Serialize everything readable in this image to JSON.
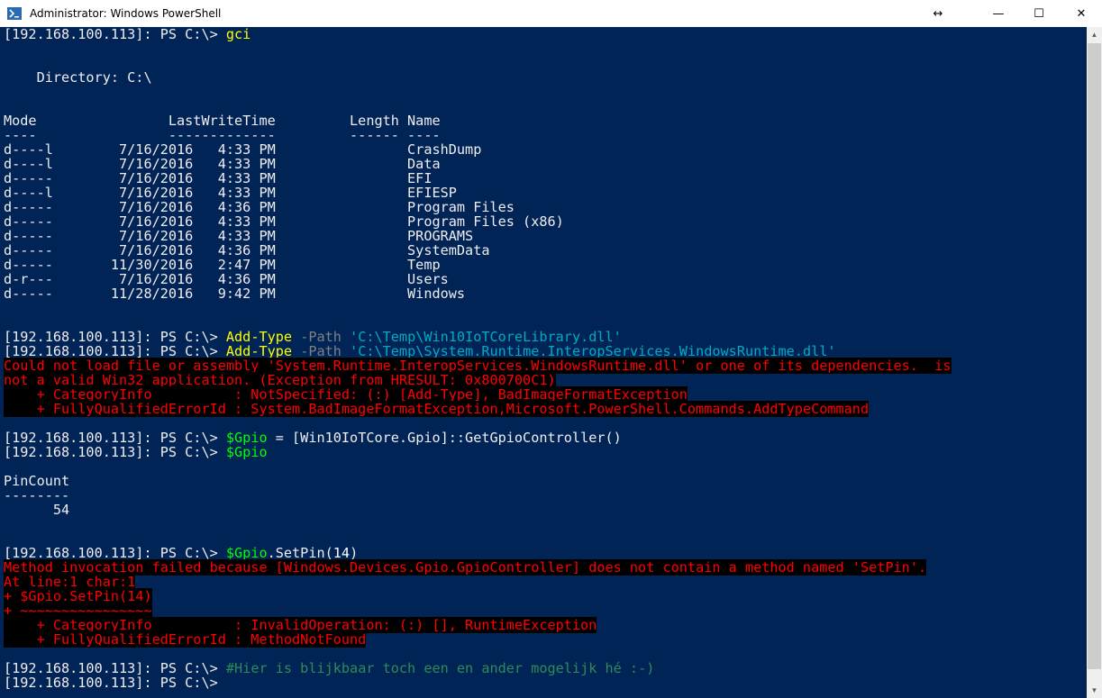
{
  "window": {
    "title": "Administrator: Windows PowerShell",
    "buttons": {
      "resize": "↔",
      "minimize": "—",
      "maximize": "☐",
      "close": "✕"
    }
  },
  "console": {
    "lines": [
      [
        {
          "t": "[192.168.100.113]: PS C:\\> ",
          "c": ""
        },
        {
          "t": "gci",
          "c": "cmd"
        }
      ],
      [],
      [],
      [
        {
          "t": "    Directory: C:\\",
          "c": ""
        }
      ],
      [],
      [],
      [
        {
          "t": "Mode                LastWriteTime         Length Name",
          "c": ""
        }
      ],
      [
        {
          "t": "----                -------------         ------ ----",
          "c": ""
        }
      ],
      [
        {
          "t": "d----l        7/16/2016   4:33 PM                CrashDump",
          "c": ""
        }
      ],
      [
        {
          "t": "d----l        7/16/2016   4:33 PM                Data",
          "c": ""
        }
      ],
      [
        {
          "t": "d-----        7/16/2016   4:33 PM                EFI",
          "c": ""
        }
      ],
      [
        {
          "t": "d----l        7/16/2016   4:33 PM                EFIESP",
          "c": ""
        }
      ],
      [
        {
          "t": "d-----        7/16/2016   4:36 PM                Program Files",
          "c": ""
        }
      ],
      [
        {
          "t": "d-----        7/16/2016   4:33 PM                Program Files (x86)",
          "c": ""
        }
      ],
      [
        {
          "t": "d-----        7/16/2016   4:33 PM                PROGRAMS",
          "c": ""
        }
      ],
      [
        {
          "t": "d-----        7/16/2016   4:36 PM                SystemData",
          "c": ""
        }
      ],
      [
        {
          "t": "d-----       11/30/2016   2:47 PM                Temp",
          "c": ""
        }
      ],
      [
        {
          "t": "d-r---        7/16/2016   4:36 PM                Users",
          "c": ""
        }
      ],
      [
        {
          "t": "d-----       11/28/2016   9:42 PM                Windows",
          "c": ""
        }
      ],
      [],
      [],
      [
        {
          "t": "[192.168.100.113]: PS C:\\> ",
          "c": ""
        },
        {
          "t": "Add-Type",
          "c": "cmd"
        },
        {
          "t": " -Path ",
          "c": "param"
        },
        {
          "t": "'C:\\Temp\\Win10IoTCoreLibrary.dll'",
          "c": "str"
        }
      ],
      [
        {
          "t": "[192.168.100.113]: PS C:\\> ",
          "c": ""
        },
        {
          "t": "Add-Type",
          "c": "cmd"
        },
        {
          "t": " -Path ",
          "c": "param"
        },
        {
          "t": "'C:\\Temp\\System.Runtime.InteropServices.WindowsRuntime.dll'",
          "c": "str"
        }
      ],
      [
        {
          "t": "Could not load file or assembly 'System.Runtime.InteropServices.WindowsRuntime.dll' or one of its dependencies.  is",
          "c": "err"
        }
      ],
      [
        {
          "t": "not a valid Win32 application. (Exception from HRESULT: 0x800700C1)",
          "c": "err"
        }
      ],
      [
        {
          "t": "    + CategoryInfo          : NotSpecified: (:) [Add-Type], BadImageFormatException",
          "c": "err"
        }
      ],
      [
        {
          "t": "    + FullyQualifiedErrorId : System.BadImageFormatException,Microsoft.PowerShell.Commands.AddTypeCommand",
          "c": "err"
        }
      ],
      [],
      [
        {
          "t": "[192.168.100.113]: PS C:\\> ",
          "c": ""
        },
        {
          "t": "$Gpio",
          "c": "var"
        },
        {
          "t": " = [Win10IoTCore.Gpio]::GetGpioController()",
          "c": ""
        }
      ],
      [
        {
          "t": "[192.168.100.113]: PS C:\\> ",
          "c": ""
        },
        {
          "t": "$Gpio",
          "c": "var"
        }
      ],
      [],
      [
        {
          "t": "PinCount",
          "c": ""
        }
      ],
      [
        {
          "t": "--------",
          "c": ""
        }
      ],
      [
        {
          "t": "      54",
          "c": ""
        }
      ],
      [],
      [],
      [
        {
          "t": "[192.168.100.113]: PS C:\\> ",
          "c": ""
        },
        {
          "t": "$Gpio",
          "c": "var"
        },
        {
          "t": ".SetPin(",
          "c": ""
        },
        {
          "t": "14",
          "c": "num"
        },
        {
          "t": ")",
          "c": ""
        }
      ],
      [
        {
          "t": "Method invocation failed because [Windows.Devices.Gpio.GpioController] does not contain a method named 'SetPin'.",
          "c": "err"
        }
      ],
      [
        {
          "t": "At line:1 char:1",
          "c": "err"
        }
      ],
      [
        {
          "t": "+ $Gpio.SetPin(14)",
          "c": "err"
        }
      ],
      [
        {
          "t": "+ ~~~~~~~~~~~~~~~~",
          "c": "err"
        }
      ],
      [
        {
          "t": "    + CategoryInfo          : InvalidOperation: (:) [], RuntimeException",
          "c": "err"
        }
      ],
      [
        {
          "t": "    + FullyQualifiedErrorId : MethodNotFound",
          "c": "err"
        }
      ],
      [],
      [
        {
          "t": "[192.168.100.113]: PS C:\\> ",
          "c": ""
        },
        {
          "t": "#Hier is blijkbaar toch een en ander mogelijk hé :-)",
          "c": "comment"
        }
      ],
      [
        {
          "t": "[192.168.100.113]: PS C:\\> ",
          "c": ""
        }
      ]
    ]
  },
  "colors": {
    "background": "#012456",
    "foreground": "#eeedf0",
    "command": "#ffff00",
    "parameter": "#808080",
    "string": "#00abc5",
    "variable": "#00ff00",
    "error": "#ff0000",
    "comment": "#2e8b57"
  }
}
